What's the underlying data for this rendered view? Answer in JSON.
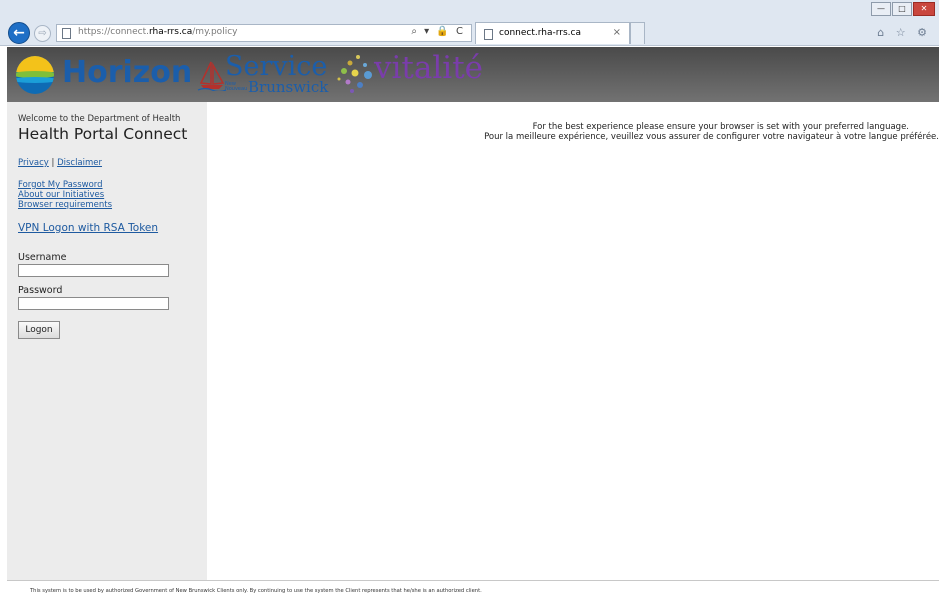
{
  "browser": {
    "url_prefix": "https://connect.",
    "url_domain": "rha-rrs.ca",
    "url_path": "/my.policy",
    "address_tools": "⌕ ▾ 🔒 C",
    "tab_title": "connect.rha-rrs.ca",
    "tab_close": "×",
    "back_glyph": "←",
    "forward_glyph": "⇨",
    "window_min": "—",
    "window_max": "□",
    "window_close": "✕",
    "toolbar_icons": "⌂ ☆ ⚙"
  },
  "banner": {
    "horizon": "Horizon",
    "service": "Service",
    "nouveau": "New\nNouveau",
    "brunswick": "Brunswick",
    "vitalite": "vitalité",
    "colors": {
      "horizon_blue": "#1b5eab",
      "vitalite_purple": "#7a3dab",
      "banner_gray": "#5a5a5a"
    }
  },
  "sidebar": {
    "welcome": "Welcome to the Department of Health",
    "title": "Health Portal Connect",
    "privacy": "Privacy",
    "separator": " | ",
    "disclaimer": "Disclaimer",
    "links": [
      "Forgot My Password",
      "About our Initiatives",
      "Browser requirements"
    ],
    "vpn": "VPN Logon with RSA Token",
    "username_label": "Username",
    "username_value": "",
    "password_label": "Password",
    "password_value": "",
    "logon_button": "Logon"
  },
  "main": {
    "message_en": "For the best experience please ensure your browser is set with your preferred language.",
    "message_fr": "Pour la meilleure expérience, veuillez vous assurer de configurer votre navigateur à votre langue préférée."
  },
  "footer": {
    "text": "This system is to be used by authorized Government of New Brunswick Clients only. By continuing to use the system the Client represents that he/she is an authorized client."
  }
}
